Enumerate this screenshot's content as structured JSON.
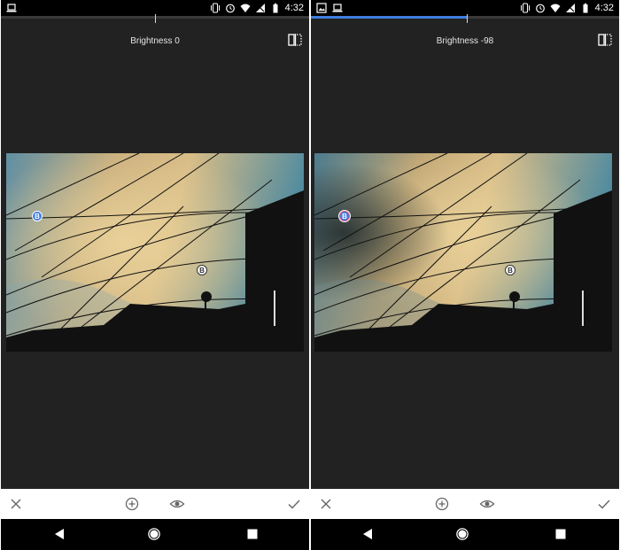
{
  "status_bar": {
    "time": "4:32"
  },
  "left_screen": {
    "title": "Brightness 0",
    "slider": {
      "fraction": 0.0
    },
    "pins": [
      {
        "label": "B",
        "selected": true
      },
      {
        "label": "B",
        "selected": false
      }
    ]
  },
  "right_screen": {
    "title": "Brightness -98",
    "slider": {
      "fraction": 0.98
    },
    "pins": [
      {
        "label": "B",
        "selected": true
      },
      {
        "label": "B",
        "selected": false
      }
    ]
  },
  "toolbar": {
    "icons": [
      "close-icon",
      "add-icon",
      "visibility-icon",
      "check-icon"
    ]
  },
  "navbar": {
    "icons": [
      "back-icon",
      "home-icon",
      "overview-icon"
    ]
  },
  "colors": {
    "accent": "#3f7ee0",
    "background": "#222222",
    "toolbar": "#ffffff"
  }
}
